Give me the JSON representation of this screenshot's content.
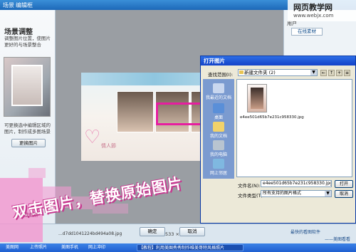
{
  "titlebar": {
    "menu1": "场景",
    "menu2": "编辑框"
  },
  "left_panel": {
    "title": "场景调整",
    "desc": "调整图片位置，使图片更好的与场景整合",
    "note": "可更换选中编辑区域的图片，制作成多图场景",
    "replace_button": "更换图片"
  },
  "scene": {
    "heart_label": "情人節"
  },
  "right_panel": {
    "user_label": "用户",
    "tab_online": "在线素材"
  },
  "watermark": {
    "line1": "网页教学网",
    "line2": "www.webjx.com"
  },
  "dialog": {
    "title": "打开图片",
    "look_in_label": "查找范围(I):",
    "look_in_value": "新建文件夹 (2)",
    "places": [
      {
        "label": "我最近的文档"
      },
      {
        "label": "桌面"
      },
      {
        "label": "我的文档"
      },
      {
        "label": "我的电脑"
      },
      {
        "label": "网上邻居"
      }
    ],
    "file_name_display": "e4ee501d65b7e231c958330.jpg",
    "file_name_label": "文件名(N):",
    "file_name_value": "e4ee501d65b7e231c958330.jpg",
    "file_type_label": "文件类型(T):",
    "file_type_value": "所有支持的图片格式",
    "open_button": "打开",
    "cancel_button": "取消"
  },
  "bottom": {
    "file_label": "...d7dd1041224bd494a08.jpg",
    "size_label": "533 × 800",
    "ok_button": "确定",
    "cancel_button": "取消",
    "right_link": "最快的看图软件",
    "right_link2": "——美图看看"
  },
  "caption": {
    "text": "双击图片，替换原始图片",
    "sub_label": "摸载点"
  },
  "taskbar": {
    "items": [
      "美图网",
      "上传照片",
      "美图手机",
      "网上冲印",
      "【教程】利用美图秀秀制作唯美哥特风格照片"
    ]
  }
}
